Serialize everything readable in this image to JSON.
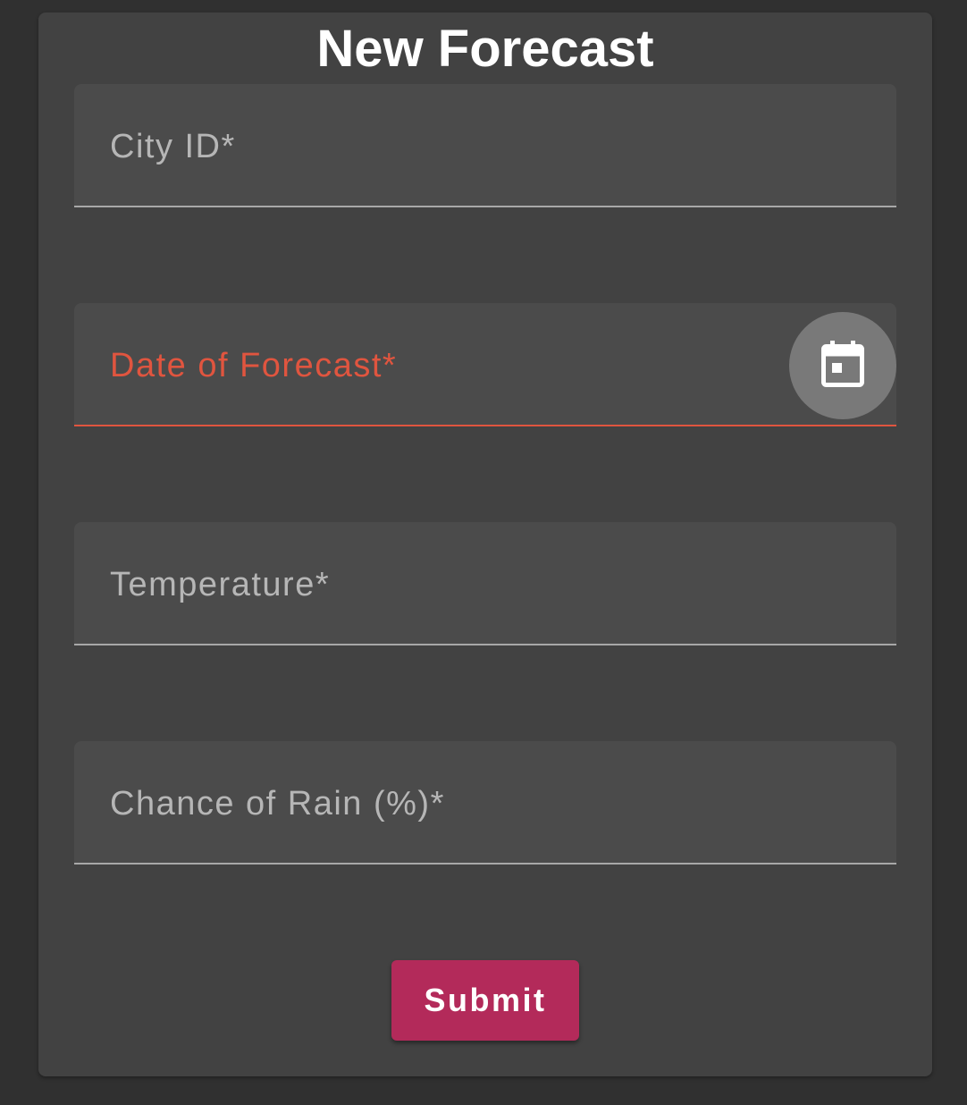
{
  "form": {
    "title": "New Forecast",
    "fields": [
      {
        "label": "City ID*",
        "value": "",
        "state": "default"
      },
      {
        "label": "Date of Forecast*",
        "value": "",
        "state": "error"
      },
      {
        "label": "Temperature*",
        "value": "",
        "state": "default"
      },
      {
        "label": "Chance of Rain (%)*",
        "value": "",
        "state": "default"
      }
    ],
    "date_picker_icon": "calendar-icon",
    "submit_label": "Submit"
  },
  "colors": {
    "background": "#303030",
    "card": "#424242",
    "field": "#4b4b4b",
    "error": "#e0553f",
    "accent": "#b32a5a"
  }
}
